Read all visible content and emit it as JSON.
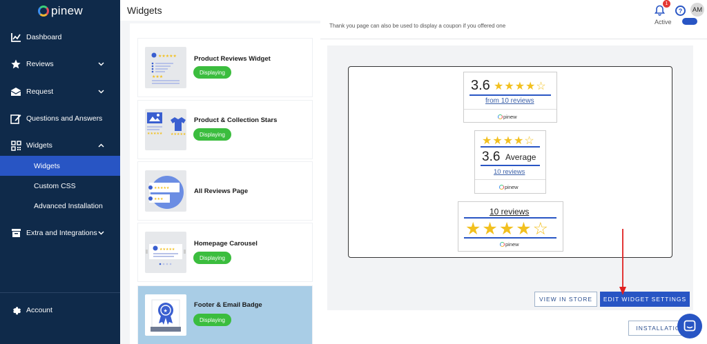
{
  "brand": {
    "name": "pinew"
  },
  "sidebar": {
    "items": [
      {
        "label": "Dashboard",
        "icon": "chart-icon"
      },
      {
        "label": "Reviews",
        "icon": "star-icon"
      },
      {
        "label": "Request",
        "icon": "envelope-icon"
      },
      {
        "label": "Questions and Answers",
        "icon": "edit-icon"
      },
      {
        "label": "Widgets",
        "icon": "qr-icon"
      },
      {
        "label": "Extra and Integrations",
        "icon": "archive-icon"
      }
    ],
    "sub_items": [
      "Widgets",
      "Custom CSS",
      "Advanced Installation"
    ],
    "account": "Account"
  },
  "header": {
    "title": "Widgets",
    "notification_count": "1",
    "help": "?",
    "avatar": "AM"
  },
  "widgets": [
    {
      "title": "Product Reviews Widget",
      "status": "Displaying"
    },
    {
      "title": "Product & Collection Stars",
      "status": "Displaying"
    },
    {
      "title": "All Reviews Page",
      "status": ""
    },
    {
      "title": "Homepage Carousel",
      "status": "Displaying"
    },
    {
      "title": "Footer & Email Badge",
      "status": "Displaying"
    }
  ],
  "preview": {
    "description": "Thank you page can also be used to display a coupon if you offered one",
    "active_label": "Active",
    "badge1": {
      "score": "3.6",
      "stars": "★★★★☆",
      "from": "from 10 reviews",
      "brand": "pinew"
    },
    "badge2": {
      "stars": "★★★★☆",
      "score": "3.6",
      "average": "Average",
      "reviews": "10 reviews",
      "brand": "pinew"
    },
    "badge3": {
      "reviews": "10 reviews",
      "stars": "★★★★☆",
      "brand": "pinew"
    }
  },
  "actions": {
    "view_in_store": "VIEW IN STORE",
    "edit_settings": "EDIT WIDGET SETTINGS",
    "installation": "INSTALLATION"
  },
  "colors": {
    "sidebar_bg": "#0f2a4a",
    "accent": "#2855c4",
    "success": "#3bbd3e",
    "star": "#f2c01f",
    "selected_card": "#a9cde6",
    "annotation_arrow": "#e02020"
  }
}
